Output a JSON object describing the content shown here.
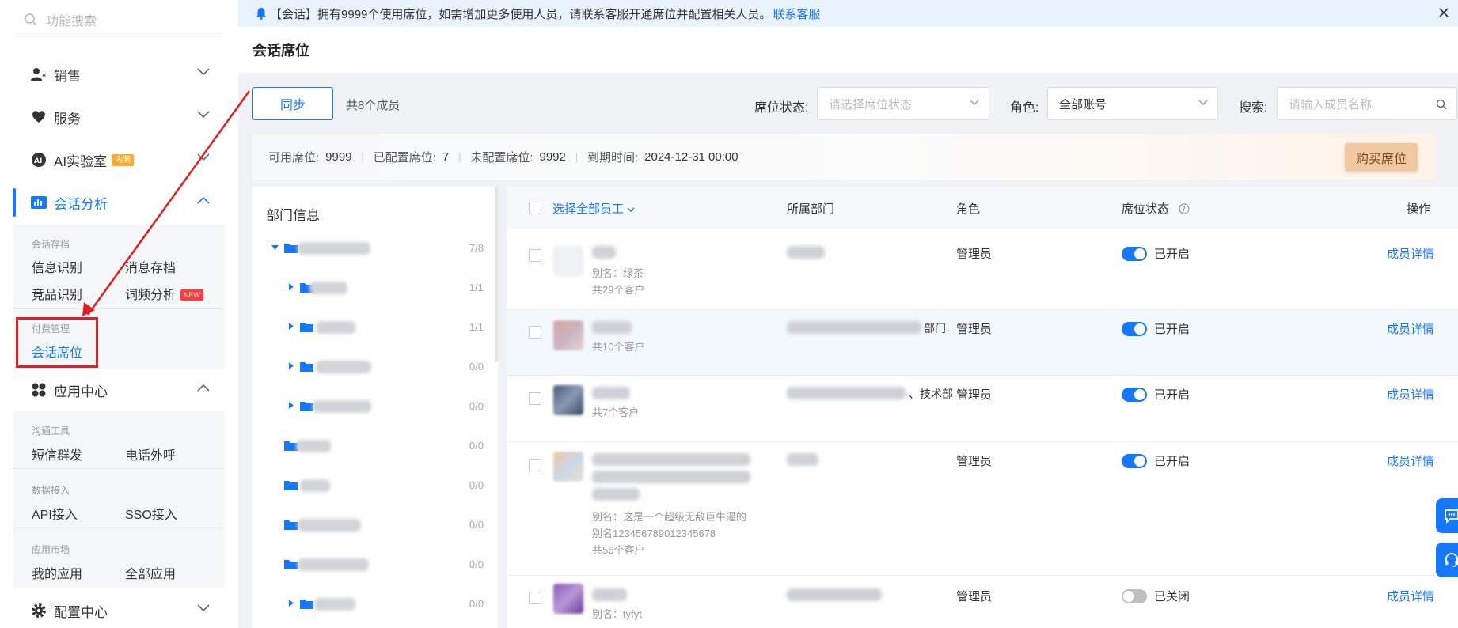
{
  "sidebar": {
    "search_placeholder": "功能搜索",
    "nav": {
      "sales": "销售",
      "service": "服务",
      "ai_lab": "AI实验室",
      "ai_lab_badge": "内测",
      "session_analysis": "会话分析",
      "app_center": "应用中心",
      "config_center": "配置中心"
    },
    "session_sub": {
      "group_archive": "会话存档",
      "info_recognition": "信息识别",
      "message_archive": "消息存档",
      "competitor_recognition": "竞品识别",
      "word_freq": "词频分析",
      "word_freq_badge": "NEW",
      "group_paid": "付费管理",
      "session_seats": "会话席位"
    },
    "app_sub": {
      "group_comm": "沟通工具",
      "sms_group": "短信群发",
      "phone_call": "电话外呼",
      "group_data": "数据接入",
      "api": "API接入",
      "sso": "SSO接入",
      "group_market": "应用市场",
      "my_apps": "我的应用",
      "all_apps": "全部应用"
    }
  },
  "notice": {
    "prefix": "【会话】",
    "text": "拥有9999个使用席位，如需增加更多使用人员，请联系客服开通席位并配置相关人员。",
    "link": "联系客服"
  },
  "page_title": "会话席位",
  "toolbar": {
    "sync_label": "同步",
    "member_count": "共8个成员",
    "seat_status_label": "席位状态:",
    "seat_status_placeholder": "请选择席位状态",
    "role_label": "角色:",
    "role_value": "全部账号",
    "search_label": "搜索:",
    "search_placeholder": "请输入成员名称"
  },
  "stats": {
    "available_label": "可用席位:",
    "available": "9999",
    "configured_label": "已配置席位:",
    "configured": "7",
    "unconfigured_label": "未配置席位:",
    "unconfigured": "9992",
    "expire_label": "到期时间:",
    "expire": "2024-12-31 00:00",
    "buy_label": "购买席位"
  },
  "dept": {
    "title": "部门信息",
    "counts": [
      "7/8",
      "1/1",
      "1/1",
      "0/0",
      "0/0",
      "0/0",
      "0/0",
      "0/0",
      "0/0",
      "0/0"
    ]
  },
  "table": {
    "headers": {
      "select_all": "选择全部员工",
      "department": "所属部门",
      "role": "角色",
      "seat_status": "席位状态",
      "action": "操作"
    },
    "rows": [
      {
        "dept_suffix": "",
        "alias": "别名：绿茶",
        "customers": "共29个客户",
        "role": "管理员",
        "status": "已开启",
        "on": true,
        "action": "成员详情"
      },
      {
        "dept_suffix": "部门",
        "alias": "",
        "customers": "共10个客户",
        "role": "管理员",
        "status": "已开启",
        "on": true,
        "action": "成员详情"
      },
      {
        "dept_suffix": "、技术部",
        "alias": "",
        "customers": "共7个客户",
        "role": "管理员",
        "status": "已开启",
        "on": true,
        "action": "成员详情"
      },
      {
        "dept_suffix": "",
        "alias_line1": "别名：这是一个超级无敌巨牛逼的",
        "alias_line2": "别名123456789012345678",
        "customers": "共56个客户",
        "role": "管理员",
        "status": "已开启",
        "on": true,
        "action": "成员详情"
      },
      {
        "dept_suffix": "",
        "alias": "别名：tyfyt",
        "customers": "",
        "role": "管理员",
        "status": "已关闭",
        "on": false,
        "action": "成员详情"
      }
    ]
  },
  "colors": {
    "primary": "#1677ff",
    "annotation_red": "#e02020",
    "buy_button": "#f2c8a0",
    "notice_bg": "#e9f3fd"
  }
}
